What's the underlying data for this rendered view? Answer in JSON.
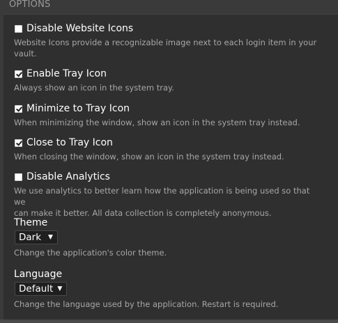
{
  "section": {
    "title": "OPTIONS"
  },
  "options": [
    {
      "label": "Disable Website Icons",
      "checked": false,
      "description_line1": "Website Icons provide a recognizable image next to each login item in your",
      "description_line2": "vault."
    },
    {
      "label": "Enable Tray Icon",
      "checked": true,
      "description_line1": "Always show an icon in the system tray."
    },
    {
      "label": "Minimize to Tray Icon",
      "checked": true,
      "description_line1": "When minimizing the window, show an icon in the system tray instead."
    },
    {
      "label": "Close to Tray Icon",
      "checked": true,
      "description_line1": "When closing the window, show an icon in the system tray instead."
    },
    {
      "label": "Disable Analytics",
      "checked": false,
      "description_line1": "We use analytics to better learn how the application is being used so that we",
      "description_line2": "can make it better. All data collection is completely anonymous."
    }
  ],
  "theme": {
    "label": "Theme",
    "selected": "Dark",
    "description": "Change the application's color theme."
  },
  "language": {
    "label": "Language",
    "selected": "Default",
    "description": "Change the language used by the application. Restart is required."
  },
  "icons": {
    "dropdown_arrow": "▼"
  },
  "colors": {
    "panel_bg": "#2f2f2f",
    "page_bg": "#3a3a3a",
    "text": "#ffffff",
    "muted_text": "#a7a7a7",
    "header_text": "#9a9a9a"
  }
}
